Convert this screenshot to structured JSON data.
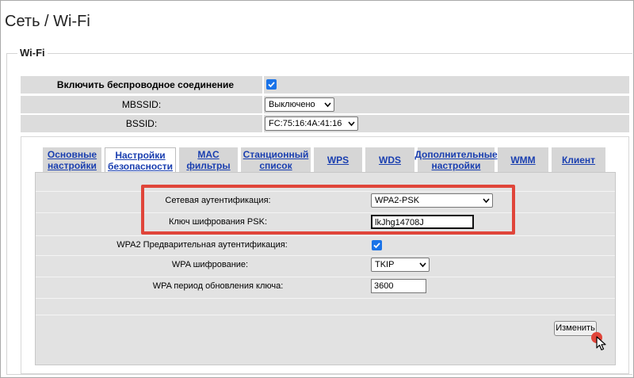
{
  "header": {
    "title": "Сеть / Wi-Fi"
  },
  "section": {
    "legend": "Wi-Fi"
  },
  "top_settings": {
    "enable_label": "Включить беспроводное соединение",
    "enable_checked": true,
    "mbssid_label": "MBSSID:",
    "mbssid_value": "Выключено",
    "bssid_label": "BSSID:",
    "bssid_value": "FC:75:16:4A:41:16"
  },
  "tabs": [
    {
      "line1": "Основные",
      "line2": "настройки",
      "active": false
    },
    {
      "line1": "Настройки",
      "line2": "безопасности",
      "active": true
    },
    {
      "line1": "MAC",
      "line2": "фильтры",
      "active": false
    },
    {
      "line1": "Станционный",
      "line2": "список",
      "active": false
    },
    {
      "line1": "WPS",
      "line2": "",
      "active": false
    },
    {
      "line1": "WDS",
      "line2": "",
      "active": false
    },
    {
      "line1": "Дополнительные",
      "line2": "настройки",
      "active": false
    },
    {
      "line1": "WMM",
      "line2": "",
      "active": false
    },
    {
      "line1": "Клиент",
      "line2": "",
      "active": false
    }
  ],
  "security": {
    "auth_label": "Сетевая аутентификация:",
    "auth_value": "WPA2-PSK",
    "psk_label": "Ключ шифрования PSK:",
    "psk_value": "lkJhg14708J",
    "preauth_label": "WPA2 Предварительная аутентификация:",
    "preauth_checked": true,
    "cipher_label": "WPA шифрование:",
    "cipher_value": "TKIP",
    "rekey_label": "WPA период обновления ключа:",
    "rekey_value": "3600"
  },
  "actions": {
    "change_label": "Изменить"
  },
  "colors": {
    "highlight": "#e0453a",
    "checkbox": "#1a73e8",
    "tab_link": "#1a3fb0"
  },
  "icons": {
    "checkbox": "checkmark-icon",
    "select": "chevron-down-icon",
    "pointer": "mouse-cursor-icon"
  }
}
